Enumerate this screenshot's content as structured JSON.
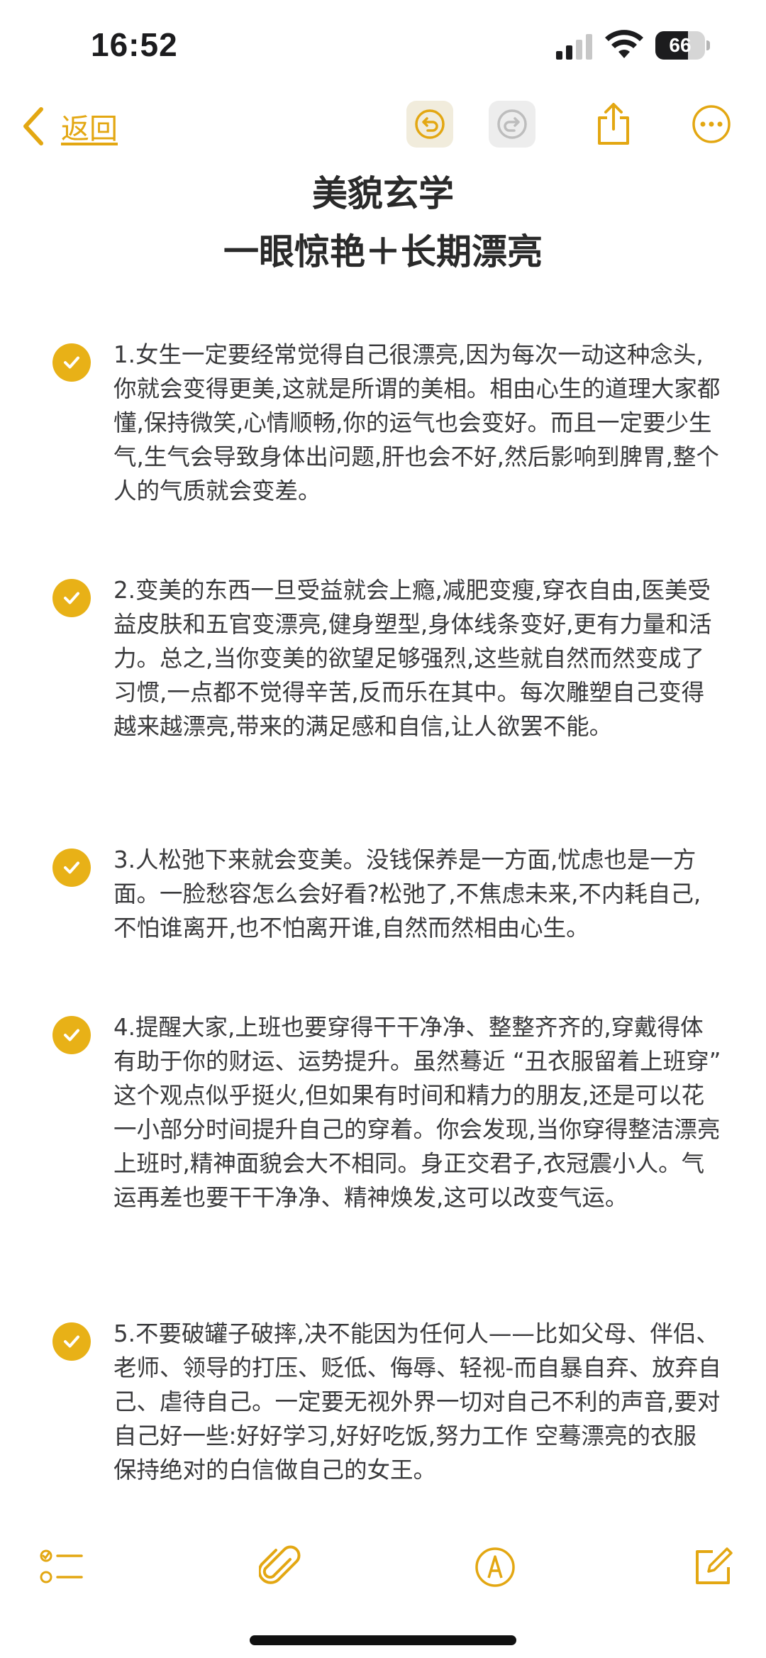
{
  "status_bar": {
    "time": "16:52",
    "battery_level": "66",
    "battery_fraction": 0.66,
    "icons": [
      "cellular-signal-icon",
      "wifi-icon",
      "battery-icon"
    ]
  },
  "nav": {
    "back_label": "返回",
    "icons": [
      "chevron-left-icon",
      "undo-icon",
      "redo-icon",
      "share-icon",
      "more-icon"
    ],
    "accent_color": "#e3a712"
  },
  "note": {
    "title_line1": "美貌玄学",
    "title_line2": "一眼惊艳＋长期漂亮",
    "items": [
      {
        "checked": true,
        "text": "1.女生一定要经常觉得自己很漂亮,因为每次一动这种念头,你就会变得更美,这就是所谓的美相。相由心生的道理大家都懂,保持微笑,心情顺畅,你的运气也会变好。而且一定要少生气,生气会导致身体出问题,肝也会不好,然后影响到脾胃,整个人的气质就会变差。"
      },
      {
        "checked": true,
        "text": "2.变美的东西一旦受益就会上瘾,减肥变瘦,穿衣自由,医美受益皮肤和五官变漂亮,健身塑型,身体线条变好,更有力量和活力。总之,当你变美的欲望足够强烈,这些就自然而然变成了习惯,一点都不觉得辛苦,反而乐在其中。每次雕塑自己变得越来越漂亮,带来的满足感和自信,让人欲罢不能。"
      },
      {
        "checked": true,
        "text": "3.人松弛下来就会变美。没钱保养是一方面,忧虑也是一方面。一脸愁容怎么会好看?松弛了,不焦虑未来,不内耗自己,不怕谁离开,也不怕离开谁,自然而然相由心生。"
      },
      {
        "checked": true,
        "text": "4.提醒大家,上班也要穿得干干净净、整整齐齐的,穿戴得体有助于你的财运、运势提升。虽然蓦近 “丑衣服留着上班穿” 这个观点似乎挺火,但如果有时间和精力的朋友,还是可以花一小部分时间提升自己的穿着。你会发现,当你穿得整洁漂亮上班时,精神面貌会大不相同。身正交君子,衣冠震小人。气运再差也要干干净净、精神焕发,这可以改变气运。"
      },
      {
        "checked": true,
        "text": "5.不要破罐子破摔,决不能因为任何人——比如父母、伴侣、老师、领导的打压、贬低、侮辱、轻视-而自暴自弃、放弃自己、虐待自己。一定要无视外界一切对自己不利的声音,要对自己好一些:好好学习,好好吃饭,努力工作 空蓦漂亮的衣服 保持绝对的白信做自己的女王。"
      }
    ],
    "check_color": "#e8b117"
  },
  "toolbar": {
    "icons": [
      "checklist-icon",
      "paperclip-icon",
      "markup-pen-icon",
      "compose-icon"
    ]
  }
}
